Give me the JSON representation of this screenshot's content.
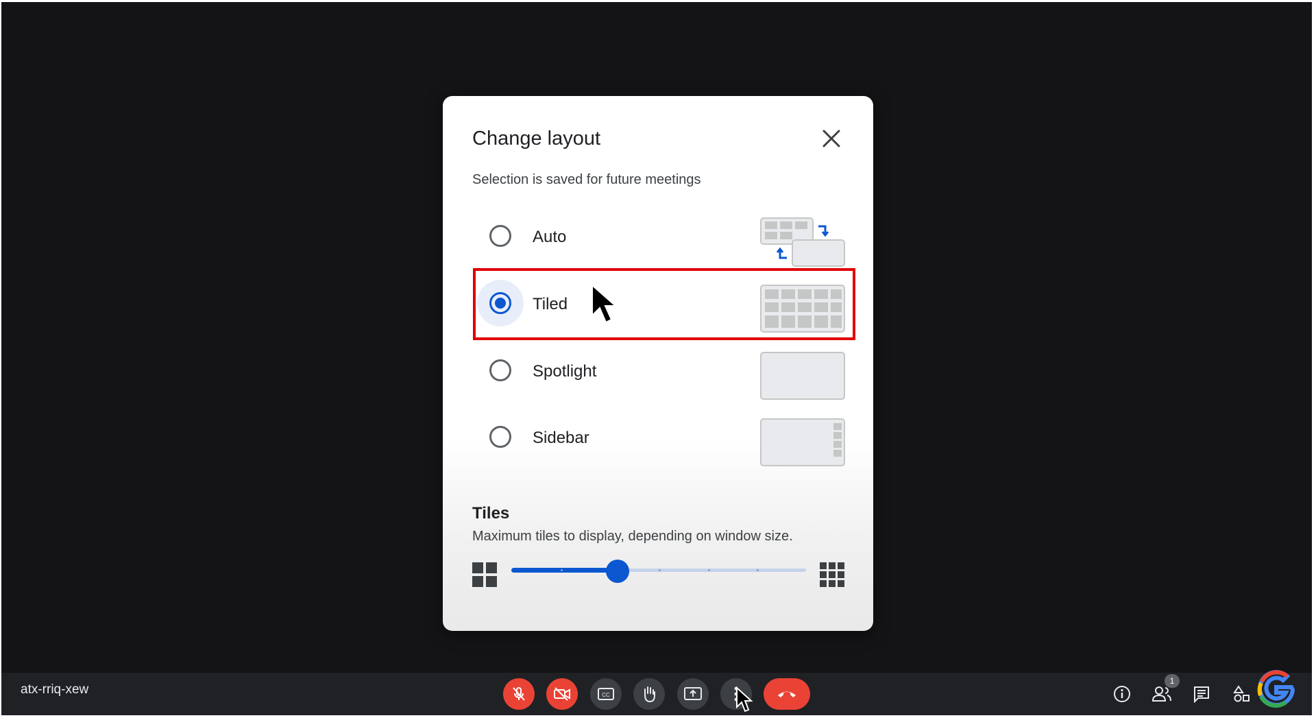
{
  "dialog": {
    "title": "Change layout",
    "subtitle": "Selection is saved for future meetings",
    "options": [
      {
        "label": "Auto",
        "selected": false,
        "thumb_icon": "auto-layout-icon"
      },
      {
        "label": "Tiled",
        "selected": true,
        "thumb_icon": "tiled-layout-icon"
      },
      {
        "label": "Spotlight",
        "selected": false,
        "thumb_icon": "spotlight-layout-icon"
      },
      {
        "label": "Sidebar",
        "selected": false,
        "thumb_icon": "sidebar-layout-icon"
      }
    ],
    "tiles": {
      "title": "Tiles",
      "description": "Maximum tiles to display, depending on window size.",
      "slider_fraction": 0.36,
      "slider_steps": 6
    }
  },
  "toolbar": {
    "meeting_code": "atx-rriq-xew",
    "participants_badge": "1"
  },
  "colors": {
    "accent": "#0b57d0",
    "danger": "#ea4335",
    "highlight_box": "#e00000",
    "toolbar_bg": "#202124",
    "stage_bg": "#141417"
  }
}
